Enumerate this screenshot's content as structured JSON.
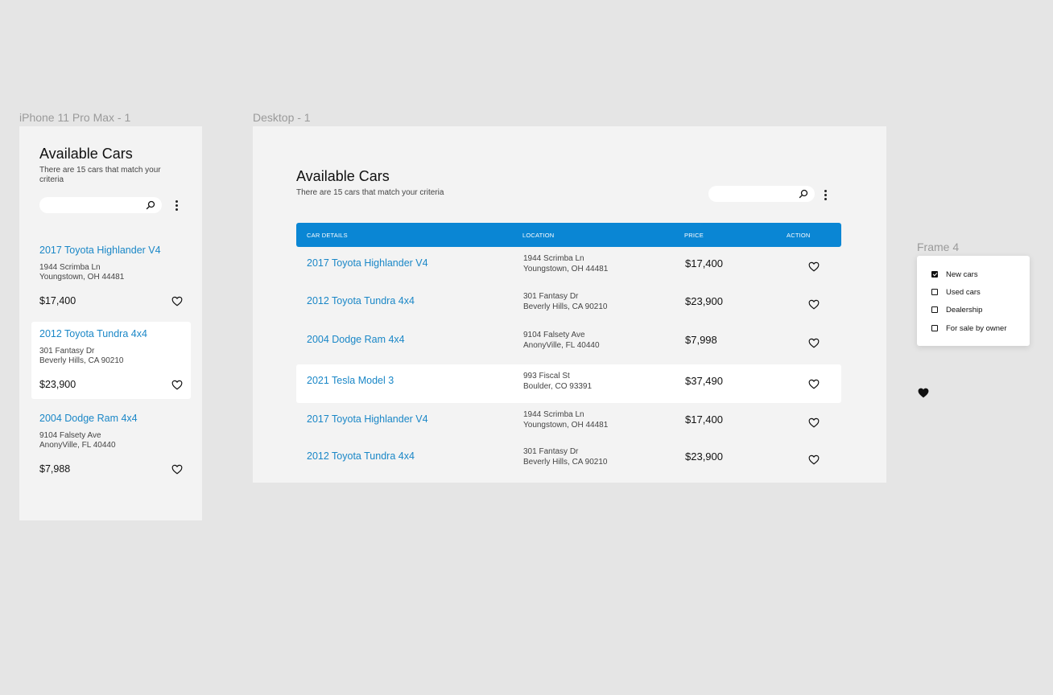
{
  "frames": {
    "phone_label": "iPhone 11 Pro Max - 1",
    "desktop_label": "Desktop - 1",
    "filter_label": "Frame 4"
  },
  "colors": {
    "canvas": "#e5e5e5",
    "frame_bg": "#f3f3f3",
    "accent_blue": "#0a86d4",
    "link_blue": "#1a87c7"
  },
  "phone": {
    "title": "Available Cars",
    "subtitle": "There are 15 cars that match your criteria",
    "search": {
      "placeholder": "",
      "icon": "search-icon"
    },
    "menu_icon": "kebab-menu-icon",
    "cards": [
      {
        "name": "2017 Toyota Highlander V4",
        "address1": "1944 Scrimba Ln",
        "address2": "Youngstown, OH 44481",
        "price": "$17,400",
        "highlighted": false
      },
      {
        "name": "2012 Toyota Tundra 4x4",
        "address1": "301 Fantasy Dr",
        "address2": "Beverly Hills, CA 90210",
        "price": "$23,900",
        "highlighted": true
      },
      {
        "name": "2004 Dodge Ram 4x4",
        "address1": "9104 Falsety Ave",
        "address2": "AnonyVille, FL 40440",
        "price": "$7,988",
        "highlighted": false
      }
    ]
  },
  "desktop": {
    "title": "Available Cars",
    "subtitle": "There are 15 cars that match your criteria",
    "search": {
      "placeholder": "",
      "icon": "search-icon"
    },
    "menu_icon": "kebab-menu-icon",
    "columns": [
      "CAR DETAILS",
      "LOCATION",
      "PRICE",
      "ACTION"
    ],
    "rows": [
      {
        "name": "2017 Toyota Highlander V4",
        "address1": "1944 Scrimba Ln",
        "address2": "Youngstown, OH 44481",
        "price": "$17,400",
        "highlighted": false
      },
      {
        "name": "2012 Toyota Tundra 4x4",
        "address1": "301 Fantasy Dr",
        "address2": "Beverly Hills, CA 90210",
        "price": "$23,900",
        "highlighted": false
      },
      {
        "name": "2004 Dodge Ram 4x4",
        "address1": "9104 Falsety Ave",
        "address2": "AnonyVille, FL 40440",
        "price": "$7,998",
        "highlighted": false
      },
      {
        "name": "2021 Tesla Model 3",
        "address1": "993 Fiscal St",
        "address2": "Boulder, CO 93391",
        "price": "$37,490",
        "highlighted": true
      },
      {
        "name": "2017 Toyota Highlander V4",
        "address1": "1944 Scrimba Ln",
        "address2": "Youngstown, OH 44481",
        "price": "$17,400",
        "highlighted": false
      },
      {
        "name": "2012 Toyota Tundra 4x4",
        "address1": "301 Fantasy Dr",
        "address2": "Beverly Hills, CA 90210",
        "price": "$23,900",
        "highlighted": false
      }
    ]
  },
  "filter": {
    "options": [
      {
        "label": "New cars",
        "checked": true
      },
      {
        "label": "Used cars",
        "checked": false
      },
      {
        "label": "Dealership",
        "checked": false
      },
      {
        "label": "For sale by owner",
        "checked": false
      }
    ]
  },
  "extra_icon": "heart-filled-icon"
}
